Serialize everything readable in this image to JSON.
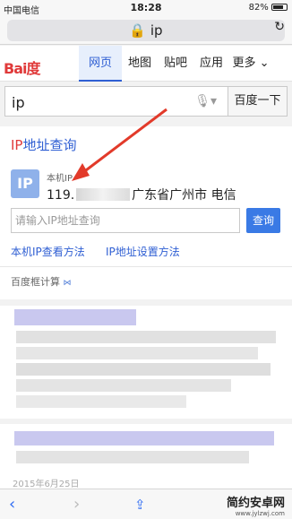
{
  "status": {
    "carrier": "中国电信",
    "time": "18:28",
    "battery": "82%",
    "battery_level": 0.82
  },
  "browser": {
    "url": "ip"
  },
  "nav": {
    "logo": "Bai度",
    "tabs": [
      "网页",
      "地图",
      "贴吧",
      "应用",
      "更多"
    ]
  },
  "search": {
    "query": "ip",
    "button": "百度一下"
  },
  "ipcard": {
    "title_ip": "IP",
    "title_rest": "地址查询",
    "badge": "IP",
    "label": "本机IP",
    "value_prefix": "119.",
    "location": "广东省广州市 电信",
    "input_placeholder": "请输入IP地址查询",
    "query_button": "查询",
    "link1": "本机IP查看方法",
    "link2": "IP地址设置方法",
    "footer": "百度框计算"
  },
  "results": {
    "date": "2015年6月25日"
  },
  "watermark": {
    "title": "简约安卓网",
    "url": "www.jylzwj.com"
  }
}
